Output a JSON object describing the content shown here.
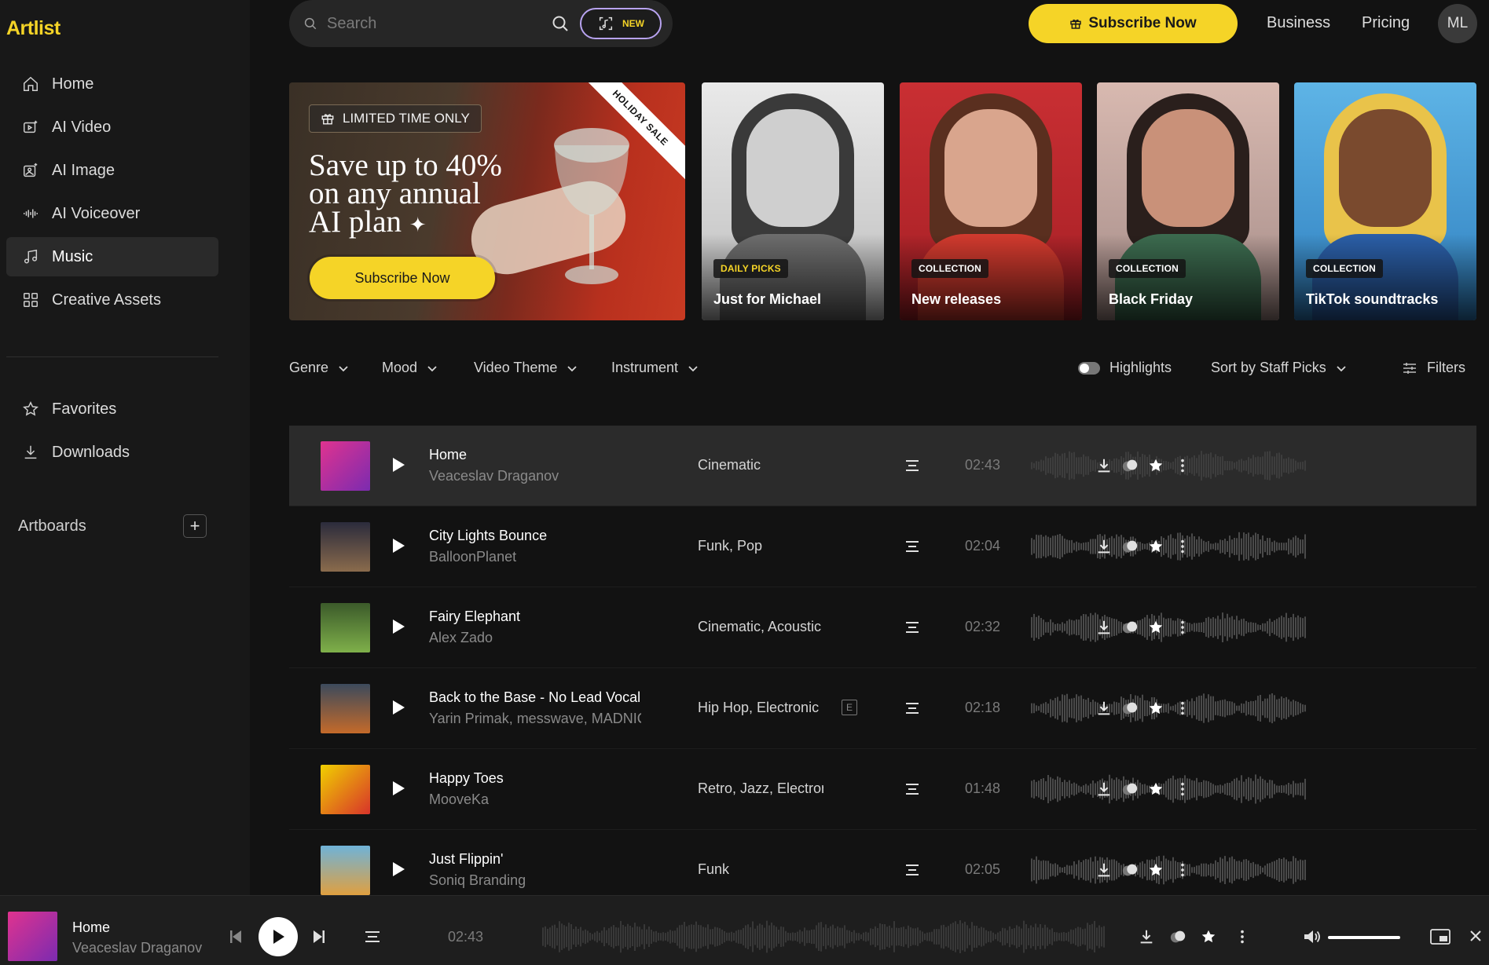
{
  "app": {
    "logo": "Artlist"
  },
  "sidebar": {
    "items": [
      {
        "label": "Home",
        "icon": "home-icon"
      },
      {
        "label": "AI Video",
        "icon": "ai-video-icon"
      },
      {
        "label": "AI Image",
        "icon": "ai-image-icon"
      },
      {
        "label": "AI Voiceover",
        "icon": "voiceover-icon"
      },
      {
        "label": "Music",
        "icon": "music-note-icon",
        "active": true
      },
      {
        "label": "Creative Assets",
        "icon": "grid-icon"
      }
    ],
    "secondary": [
      {
        "label": "Favorites",
        "icon": "star-icon"
      },
      {
        "label": "Downloads",
        "icon": "download-icon"
      }
    ],
    "artboards_label": "Artboards"
  },
  "search": {
    "placeholder": "Search",
    "new_badge": "NEW"
  },
  "header": {
    "subscribe_label": "Subscribe Now",
    "business_label": "Business",
    "pricing_label": "Pricing",
    "avatar_initials": "ML"
  },
  "banner": {
    "limited_label": "LIMITED TIME ONLY",
    "title_line1": "Save up to 40%",
    "title_line2": "on any annual",
    "title_line3": "AI plan",
    "cta_label": "Subscribe Now",
    "ribbon": "HOLIDAY SALE"
  },
  "collections": [
    {
      "tag": "DAILY PICKS",
      "name": "Just for Michael"
    },
    {
      "tag": "COLLECTION",
      "name": "New releases"
    },
    {
      "tag": "COLLECTION",
      "name": "Black Friday"
    },
    {
      "tag": "COLLECTION",
      "name": "TikTok soundtracks"
    }
  ],
  "filters": {
    "genre": "Genre",
    "mood": "Mood",
    "video_theme": "Video Theme",
    "instrument": "Instrument",
    "highlights": "Highlights",
    "sort": "Sort by Staff Picks",
    "filters": "Filters"
  },
  "tracks": [
    {
      "title": "Home",
      "artist": "Veaceslav Draganov",
      "genre": "Cinematic",
      "duration": "02:43",
      "explicit": false
    },
    {
      "title": "City Lights Bounce",
      "artist": "BalloonPlanet",
      "genre": "Funk, Pop",
      "duration": "02:04",
      "explicit": false
    },
    {
      "title": "Fairy Elephant",
      "artist": "Alex Zado",
      "genre": "Cinematic, Acoustic",
      "duration": "02:32",
      "explicit": false
    },
    {
      "title": "Back to the Base - No Lead Vocal",
      "artist": "Yarin Primak, messwave, MADNIC",
      "genre": "Hip Hop, Electronic",
      "duration": "02:18",
      "explicit": true,
      "explicit_label": "E"
    },
    {
      "title": "Happy Toes",
      "artist": "MooveKa",
      "genre": "Retro, Jazz, Electronic",
      "duration": "01:48",
      "explicit": false
    },
    {
      "title": "Just Flippin'",
      "artist": "Soniq Branding",
      "genre": "Funk",
      "duration": "02:05",
      "explicit": false
    }
  ],
  "player": {
    "title": "Home",
    "artist": "Veaceslav Draganov",
    "duration": "02:43",
    "volume": 1.0
  },
  "colors": {
    "accent": "#f5d427",
    "background": "#121212",
    "sidebar": "#181818",
    "active_row": "#2b2b2b"
  }
}
